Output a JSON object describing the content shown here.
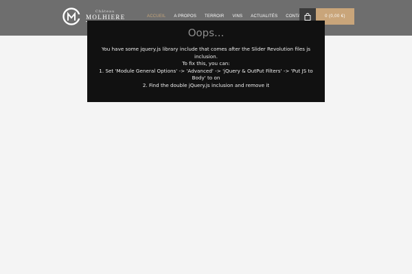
{
  "header": {
    "logo": {
      "small_text": "Château",
      "big_text": "MOLHIERE",
      "mark_letters": "CM"
    },
    "nav": [
      {
        "label": "ACCUEIL",
        "active": true
      },
      {
        "label": "A PROPOS",
        "active": false
      },
      {
        "label": "TERROIR",
        "active": false
      },
      {
        "label": "VINS",
        "active": false
      },
      {
        "label": "ACTUALITÉS",
        "active": false
      },
      {
        "label": "CONTACTS",
        "active": false
      }
    ],
    "cart": {
      "icon": "shopping-bag-icon",
      "total": "0 (0,00 €)"
    }
  },
  "error": {
    "title": "Oops...",
    "line1": "You have some jquery.js library include that comes after the Slider Revolution files js inclusion.",
    "line2": "To fix this, you can:",
    "line3": "1. Set 'Module General Options' -> 'Advanced' -> 'jQuery & OutPut Filters' -> 'Put JS to Body' to on",
    "line4": "2. Find the double jQuery.js inclusion and remove it"
  },
  "colors": {
    "header_bg": "#6e6e6e",
    "accent_gold": "#c9a57a",
    "page_bg": "#f4f4f4",
    "error_bg": "#111111"
  }
}
